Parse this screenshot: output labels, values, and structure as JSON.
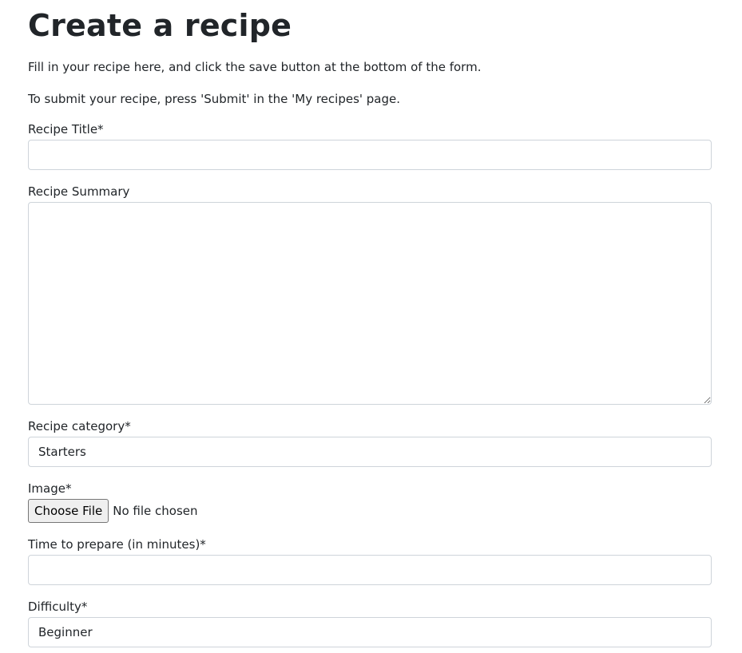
{
  "page": {
    "title": "Create a recipe",
    "intro_1": "Fill in your recipe here, and click the save button at the bottom of the form.",
    "intro_2": "To submit your recipe, press 'Submit' in the 'My recipes' page."
  },
  "form": {
    "title_field": {
      "label": "Recipe Title*",
      "value": ""
    },
    "summary_field": {
      "label": "Recipe Summary",
      "value": ""
    },
    "category_field": {
      "label": "Recipe category*",
      "selected": "Starters"
    },
    "image_field": {
      "label": "Image*",
      "button_label": "Choose File",
      "status": "No file chosen"
    },
    "time_field": {
      "label": "Time to prepare (in minutes)*",
      "value": ""
    },
    "difficulty_field": {
      "label": "Difficulty*",
      "selected": "Beginner"
    }
  },
  "colors": {
    "text": "#212529",
    "input_border": "#ced4da",
    "file_button_bg": "#efefef"
  }
}
